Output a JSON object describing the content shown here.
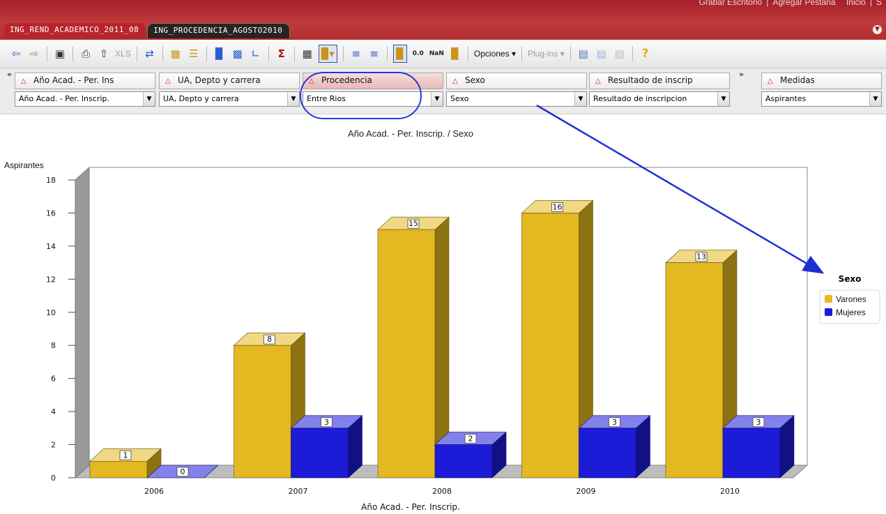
{
  "header": {
    "top_links": [
      "Grabar Escritorio",
      "Agregar Pestaña",
      "Inicio",
      "S"
    ],
    "tabs": [
      {
        "label": "ING_REND_ACADEMICO_2011_08",
        "active": false
      },
      {
        "label": "ING_PROCEDENCIA_AGOSTO2010",
        "active": true
      }
    ]
  },
  "toolbar": {
    "xls_label": "XLS",
    "decimals_label": "0.0",
    "nan_label": "NaN",
    "options_label": "Opciones",
    "plugins_label": "Plug-ins",
    "icons": [
      "back-arrow-icon",
      "forward-arrow-icon",
      "camera-icon",
      "print-icon",
      "export-icon",
      "xls-icon",
      "refresh-icon",
      "swap-axes-icon",
      "drill-icon",
      "bar-chart-icon",
      "stacked-chart-icon",
      "line-chart-icon",
      "sum-icon",
      "grid-icon",
      "chart-type-icon",
      "align-left-icon",
      "align-right-icon",
      "chart-view-icon",
      "decimals-icon",
      "nan-icon",
      "chart-settings-icon",
      "export-html-icon",
      "save-icon",
      "clear-icon",
      "help-icon"
    ]
  },
  "filters": {
    "dimensions": [
      {
        "header": "Año Acad. - Per. Ins",
        "value": "Año Acad. - Per. Inscrip."
      },
      {
        "header": "UA, Depto y carrera",
        "value": "UA, Depto y carrera"
      },
      {
        "header": "Procedencia",
        "value": "Entre Rios"
      },
      {
        "header": "Sexo",
        "value": "Sexo"
      },
      {
        "header": "Resultado de inscrip",
        "value": "Resultado de inscripcion"
      }
    ],
    "measures": {
      "header": "Medidas",
      "value": "Aspirantes"
    },
    "left_arrow": "«",
    "right_arrow": "»"
  },
  "chart_data": {
    "type": "bar",
    "title": "Año Acad. - Per. Inscrip. / Sexo",
    "xlabel": "Año Acad. - Per. Inscrip.",
    "ylabel": "Aspirantes",
    "categories": [
      "2006",
      "2007",
      "2008",
      "2009",
      "2010"
    ],
    "series": [
      {
        "name": "Varones",
        "values": [
          1,
          8,
          15,
          16,
          13
        ],
        "color": "#e3b820"
      },
      {
        "name": "Mujeres",
        "values": [
          0,
          3,
          2,
          3,
          3
        ],
        "color": "#1c1cd8"
      }
    ],
    "ylim": [
      0,
      18
    ],
    "yticks": [
      0,
      2,
      4,
      6,
      8,
      10,
      12,
      14,
      16,
      18
    ],
    "legend_title": "Sexo",
    "legend_position": "right",
    "grid": false
  }
}
